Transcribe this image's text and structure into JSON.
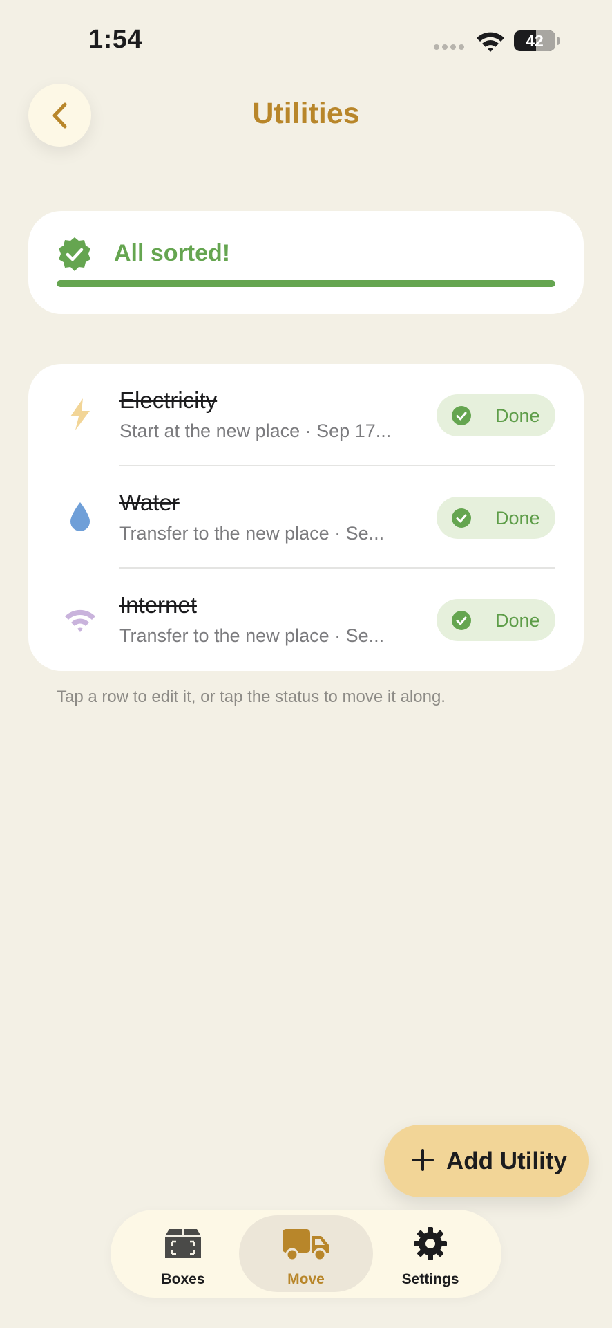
{
  "status_bar": {
    "time": "1:54",
    "battery": "42"
  },
  "header": {
    "title": "Utilities",
    "back_icon": "chevron-left-icon"
  },
  "summary": {
    "text": "All sorted!",
    "progress": 1.0,
    "accent": "#65a550"
  },
  "utilities": [
    {
      "name": "Electricity",
      "subtitle": "Start at the new place · Sep 17...",
      "icon": "lightning-icon",
      "icon_color": "#f2d597",
      "status": "Done"
    },
    {
      "name": "Water",
      "subtitle": "Transfer to the new place · Se...",
      "icon": "water-drop-icon",
      "icon_color": "#6f9fd8",
      "status": "Done"
    },
    {
      "name": "Internet",
      "subtitle": "Transfer to the new place · Se...",
      "icon": "wifi-icon",
      "icon_color": "#c9b3dc",
      "status": "Done"
    }
  ],
  "hint": "Tap a row to edit it, or tap the status to move it along.",
  "fab": {
    "label": "Add Utility"
  },
  "tabs": [
    {
      "label": "Boxes",
      "icon": "box-icon",
      "active": false
    },
    {
      "label": "Move",
      "icon": "truck-icon",
      "active": true
    },
    {
      "label": "Settings",
      "icon": "gear-icon",
      "active": false
    }
  ],
  "colors": {
    "background": "#f3f0e5",
    "brand": "#b8862a",
    "done_bg": "#e6f0dc",
    "done_text": "#5e9d49"
  }
}
